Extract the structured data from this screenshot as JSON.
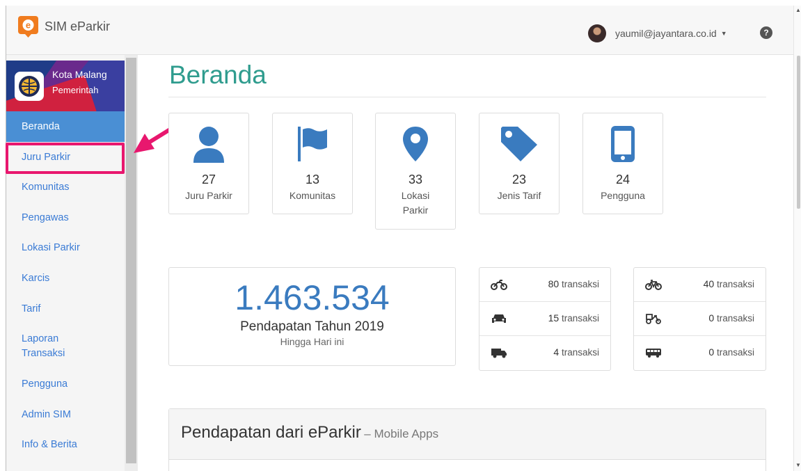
{
  "app": {
    "brand_name": "SIM eParkir",
    "brand_color": "#f07c1f"
  },
  "header": {
    "user_email": "yaumil@jayantara.co.id",
    "help_icon": "question-circle-icon"
  },
  "org": {
    "name": "Kota Malang",
    "type": "Pemerintah"
  },
  "sidebar": {
    "items": [
      {
        "label": "Beranda",
        "active": true
      },
      {
        "label": "Juru Parkir",
        "highlighted": true
      },
      {
        "label": "Komunitas"
      },
      {
        "label": "Pengawas"
      },
      {
        "label": "Lokasi Parkir"
      },
      {
        "label": "Karcis"
      },
      {
        "label": "Tarif"
      },
      {
        "label": "Laporan Transaksi"
      },
      {
        "label": "Pengguna"
      },
      {
        "label": "Admin SIM"
      },
      {
        "label": "Info & Berita"
      }
    ]
  },
  "main": {
    "title": "Beranda",
    "stats": [
      {
        "value": "27",
        "label": "Juru Parkir",
        "icon": "user-icon"
      },
      {
        "value": "13",
        "label": "Komunitas",
        "icon": "flag-icon"
      },
      {
        "value": "33",
        "label": "Lokasi Parkir",
        "icon": "map-marker-icon"
      },
      {
        "value": "23",
        "label": "Jenis Tarif",
        "icon": "tag-icon"
      },
      {
        "value": "24",
        "label": "Pengguna",
        "icon": "mobile-icon"
      }
    ],
    "revenue": {
      "amount": "1.463.534",
      "label": "Pendapatan Tahun 2019",
      "sub": "Hingga Hari ini"
    },
    "transactions_left": [
      {
        "icon": "motorcycle-icon",
        "count": "80",
        "unit": "transaksi"
      },
      {
        "icon": "car-icon",
        "count": "15",
        "unit": "transaksi"
      },
      {
        "icon": "truck-icon",
        "count": "4",
        "unit": "transaksi"
      }
    ],
    "transactions_right": [
      {
        "icon": "bicycle-icon",
        "count": "40",
        "unit": "transaksi"
      },
      {
        "icon": "becak-icon",
        "count": "0",
        "unit": "transaksi"
      },
      {
        "icon": "bus-icon",
        "count": "0",
        "unit": "transaksi"
      }
    ],
    "panel": {
      "title": "Pendapatan dari eParkir",
      "subtitle": "– Mobile Apps"
    }
  },
  "colors": {
    "title": "#2f9c8e",
    "icon": "#3a7bbf",
    "active_nav": "#4a8fd4",
    "highlight": "#e8176e"
  }
}
